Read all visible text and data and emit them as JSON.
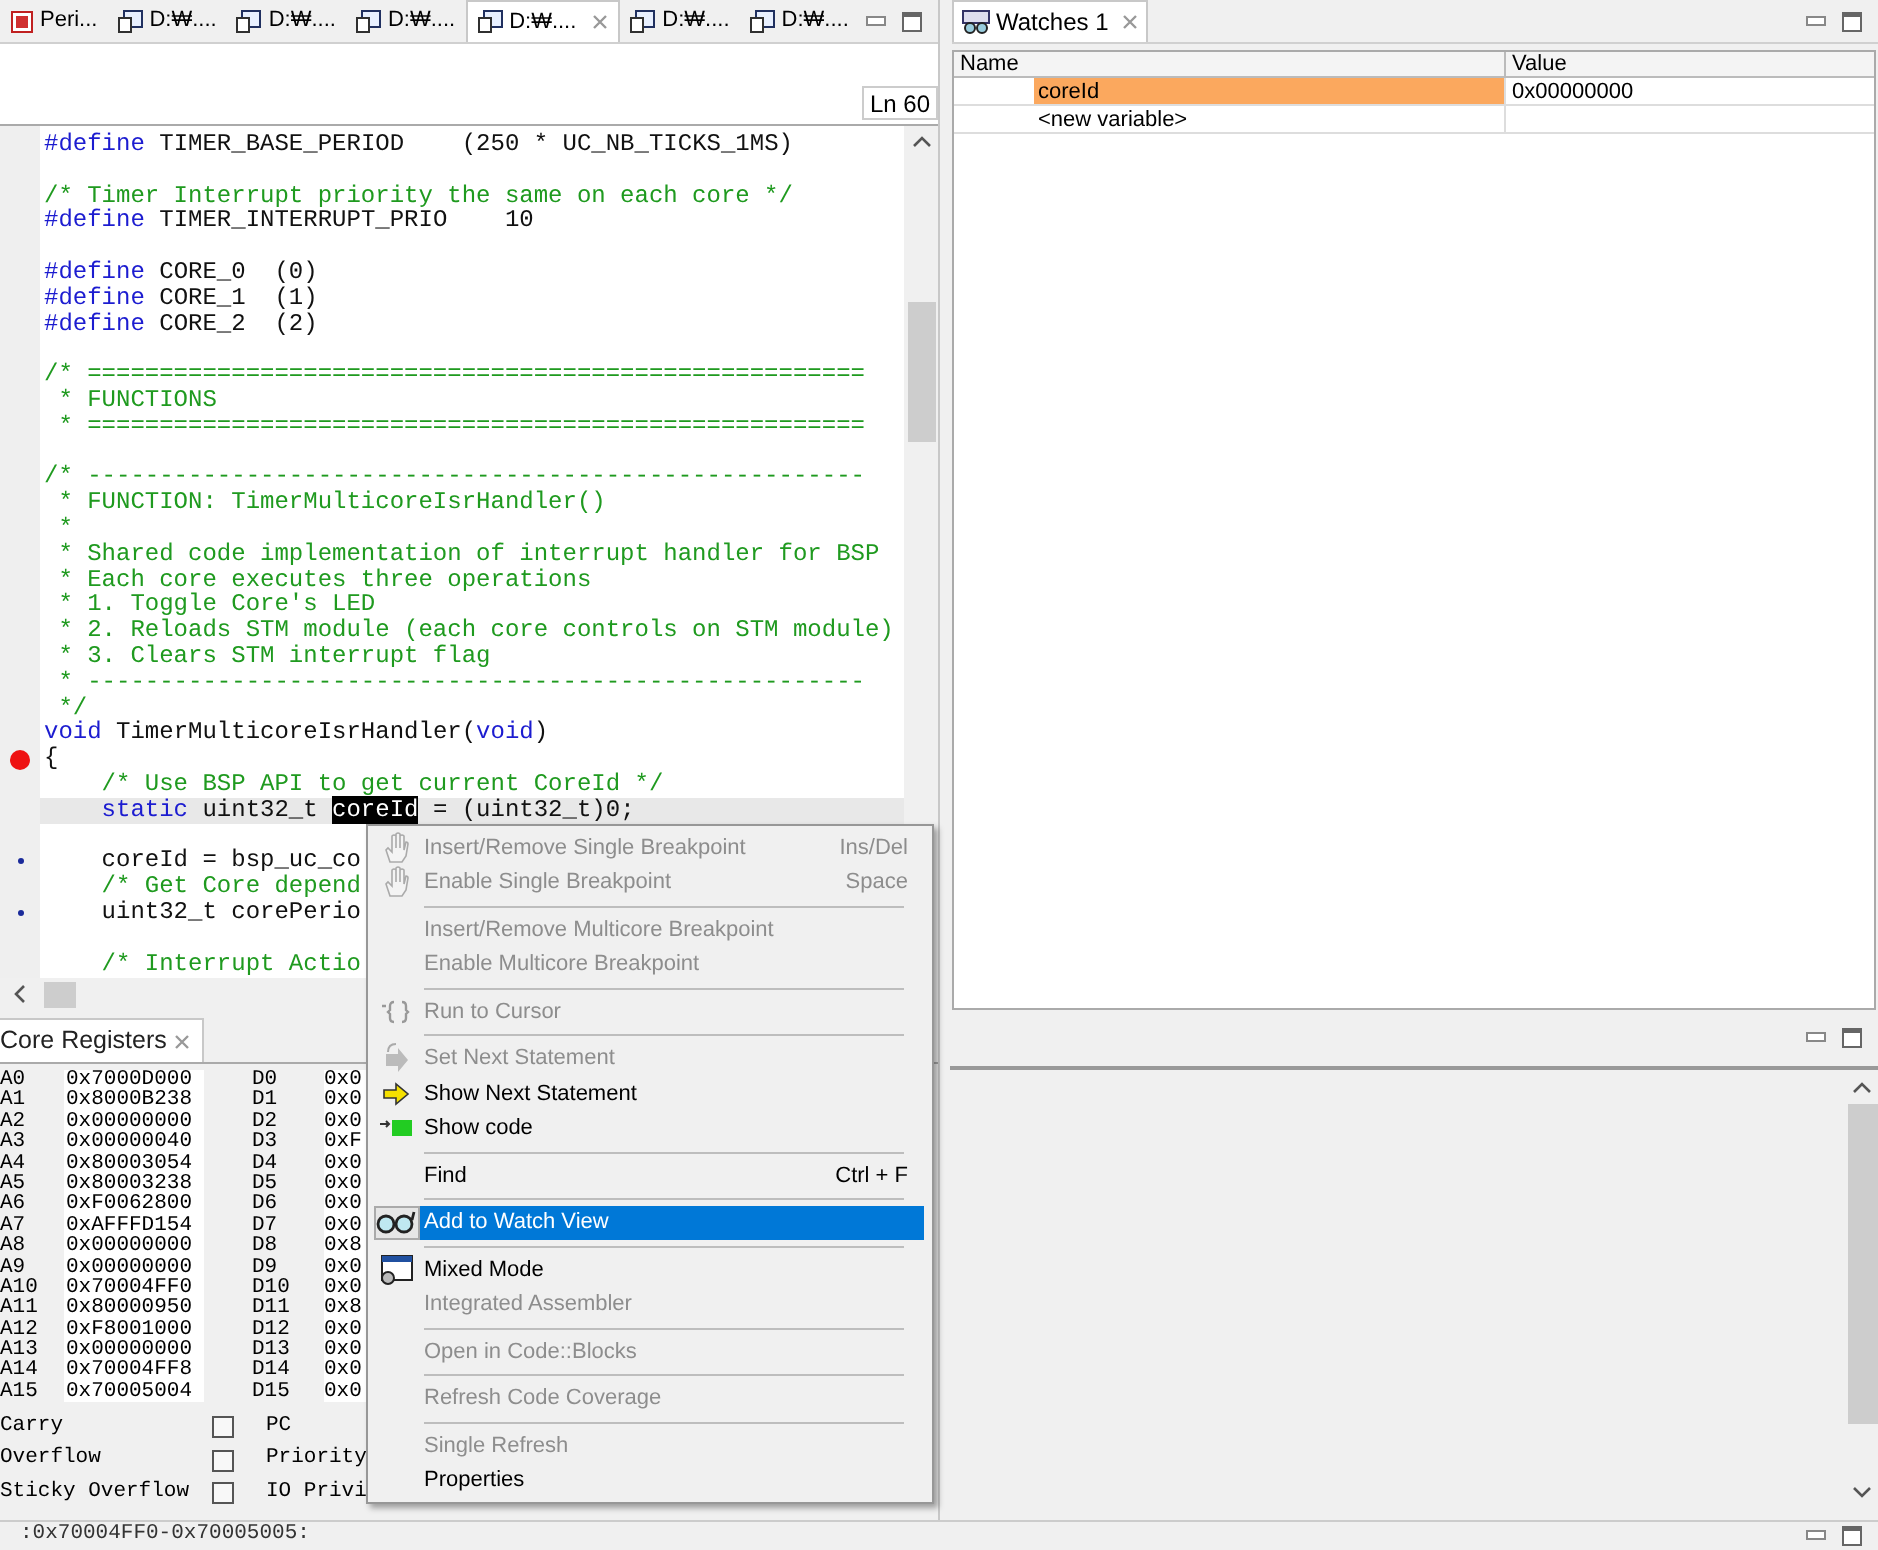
{
  "editor_tabs": [
    {
      "label": "Peri...",
      "kind": "peripheral",
      "selected": false
    },
    {
      "label": "D:₩....",
      "kind": "file",
      "selected": false
    },
    {
      "label": "D:₩....",
      "kind": "file",
      "selected": false
    },
    {
      "label": "D:₩....",
      "kind": "file",
      "selected": false
    },
    {
      "label": "D:₩....",
      "kind": "file",
      "selected": true
    },
    {
      "label": "D:₩....",
      "kind": "file",
      "selected": false
    },
    {
      "label": "D:₩....",
      "kind": "file",
      "selected": false
    }
  ],
  "line_indicator": "Ln 60",
  "code_lines": [
    {
      "kind": "code",
      "segments": [
        {
          "kind": "keyword",
          "text": "#define"
        },
        {
          "kind": "plain",
          "text": " TIMER_BASE_PERIOD    (250 * UC_NB_TICKS_1MS)"
        }
      ]
    },
    {
      "kind": "blank"
    },
    {
      "kind": "code",
      "segments": [
        {
          "kind": "comment",
          "text": "/* Timer Interrupt priority the same on each core */"
        }
      ]
    },
    {
      "kind": "code",
      "segments": [
        {
          "kind": "keyword",
          "text": "#define"
        },
        {
          "kind": "plain",
          "text": " TIMER_INTERRUPT_PRIO    10"
        }
      ]
    },
    {
      "kind": "blank"
    },
    {
      "kind": "code",
      "segments": [
        {
          "kind": "keyword",
          "text": "#define"
        },
        {
          "kind": "plain",
          "text": " CORE_0  (0)"
        }
      ]
    },
    {
      "kind": "code",
      "segments": [
        {
          "kind": "keyword",
          "text": "#define"
        },
        {
          "kind": "plain",
          "text": " CORE_1  (1)"
        }
      ]
    },
    {
      "kind": "code",
      "segments": [
        {
          "kind": "keyword",
          "text": "#define"
        },
        {
          "kind": "plain",
          "text": " CORE_2  (2)"
        }
      ]
    },
    {
      "kind": "blank"
    },
    {
      "kind": "code",
      "segments": [
        {
          "kind": "comment",
          "text": "/* ======================================================"
        }
      ]
    },
    {
      "kind": "code",
      "segments": [
        {
          "kind": "comment",
          "text": " * FUNCTIONS"
        }
      ]
    },
    {
      "kind": "code",
      "segments": [
        {
          "kind": "comment",
          "text": " * ======================================================"
        }
      ]
    },
    {
      "kind": "blank"
    },
    {
      "kind": "code",
      "segments": [
        {
          "kind": "comment",
          "text": "/* ------------------------------------------------------"
        }
      ]
    },
    {
      "kind": "code",
      "segments": [
        {
          "kind": "comment",
          "text": " * FUNCTION: TimerMulticoreIsrHandler()"
        }
      ]
    },
    {
      "kind": "code",
      "segments": [
        {
          "kind": "comment",
          "text": " *"
        }
      ]
    },
    {
      "kind": "code",
      "segments": [
        {
          "kind": "comment",
          "text": " * Shared code implementation of interrupt handler for BSP"
        }
      ]
    },
    {
      "kind": "code",
      "segments": [
        {
          "kind": "comment",
          "text": " * Each core executes three operations"
        }
      ]
    },
    {
      "kind": "code",
      "segments": [
        {
          "kind": "comment",
          "text": " * 1. Toggle Core's LED"
        }
      ]
    },
    {
      "kind": "code",
      "segments": [
        {
          "kind": "comment",
          "text": " * 2. Reloads STM module (each core controls on STM module)"
        }
      ]
    },
    {
      "kind": "code",
      "segments": [
        {
          "kind": "comment",
          "text": " * 3. Clears STM interrupt flag"
        }
      ]
    },
    {
      "kind": "code",
      "segments": [
        {
          "kind": "comment",
          "text": " * ------------------------------------------------------"
        }
      ]
    },
    {
      "kind": "code",
      "segments": [
        {
          "kind": "comment",
          "text": " */"
        }
      ]
    },
    {
      "kind": "code",
      "segments": [
        {
          "kind": "keyword",
          "text": "void"
        },
        {
          "kind": "plain",
          "text": " TimerMulticoreIsrHandler("
        },
        {
          "kind": "keyword",
          "text": "void"
        },
        {
          "kind": "plain",
          "text": ")"
        }
      ]
    },
    {
      "kind": "breakpoint",
      "segments": [
        {
          "kind": "plain",
          "text": "{"
        }
      ]
    },
    {
      "kind": "code",
      "segments": [
        {
          "kind": "comment",
          "text": "    /* Use BSP API to get current CoreId */"
        }
      ]
    },
    {
      "kind": "code",
      "current": true,
      "segments": [
        {
          "kind": "keyword",
          "text": "    static"
        },
        {
          "kind": "plain",
          "text": " uint32_t "
        },
        {
          "kind": "selection",
          "text": "coreId"
        },
        {
          "kind": "plain",
          "text": " = (uint32_t)0;"
        }
      ]
    },
    {
      "kind": "blank"
    },
    {
      "kind": "dot",
      "segments": [
        {
          "kind": "plain",
          "text": "    coreId = bsp_uc_co"
        }
      ]
    },
    {
      "kind": "code",
      "segments": [
        {
          "kind": "comment",
          "text": "    /* Get Core depend"
        }
      ]
    },
    {
      "kind": "dot",
      "segments": [
        {
          "kind": "plain",
          "text": "    uint32_t corePerio"
        }
      ]
    },
    {
      "kind": "blank"
    },
    {
      "kind": "code",
      "segments": [
        {
          "kind": "comment",
          "text": "    /* Interrupt Actio"
        }
      ]
    }
  ],
  "watches": {
    "tab": "Watches 1",
    "columns": [
      "Name",
      "Value"
    ],
    "rows": [
      {
        "name": "coreId",
        "value": "0x00000000",
        "highlighted": true
      },
      {
        "name": "<new variable>",
        "highlighted": false
      }
    ]
  },
  "registers": {
    "tab": "Core Registers",
    "rows": [
      {
        "a": "A0",
        "a_value": "0x7000D000",
        "d": "D0",
        "d_value": "0x0"
      },
      {
        "a": "A1",
        "a_value": "0x8000B238",
        "d": "D1",
        "d_value": "0x0"
      },
      {
        "a": "A2",
        "a_value": "0x00000000",
        "d": "D2",
        "d_value": "0x0"
      },
      {
        "a": "A3",
        "a_value": "0x00000040",
        "d": "D3",
        "d_value": "0xF"
      },
      {
        "a": "A4",
        "a_value": "0x80003054",
        "d": "D4",
        "d_value": "0x0"
      },
      {
        "a": "A5",
        "a_value": "0x80003238",
        "d": "D5",
        "d_value": "0x0"
      },
      {
        "a": "A6",
        "a_value": "0xF0062800",
        "d": "D6",
        "d_value": "0x0"
      },
      {
        "a": "A7",
        "a_value": "0xAFFFD154",
        "d": "D7",
        "d_value": "0x0"
      },
      {
        "a": "A8",
        "a_value": "0x00000000",
        "d": "D8",
        "d_value": "0x8"
      },
      {
        "a": "A9",
        "a_value": "0x00000000",
        "d": "D9",
        "d_value": "0x0"
      },
      {
        "a": "A10",
        "a_value": "0x70004FF0",
        "d": "D10",
        "d_value": "0x0"
      },
      {
        "a": "A11",
        "a_value": "0x80000950",
        "d": "D11",
        "d_value": "0x8"
      },
      {
        "a": "A12",
        "a_value": "0xF8001000",
        "d": "D12",
        "d_value": "0x0"
      },
      {
        "a": "A13",
        "a_value": "0x00000000",
        "d": "D13",
        "d_value": "0x0"
      },
      {
        "a": "A14",
        "a_value": "0x70004FF8",
        "d": "D14",
        "d_value": "0x0"
      },
      {
        "a": "A15",
        "a_value": "0x70005004",
        "d": "D15",
        "d_value": "0x0"
      }
    ],
    "flags": [
      {
        "label": "Carry",
        "checked": false,
        "right_label": "PC"
      },
      {
        "label": "Overflow",
        "checked": false,
        "right_label": "Priority"
      },
      {
        "label": "Sticky Overflow",
        "checked": false,
        "right_label": "IO Privi"
      }
    ]
  },
  "bottom_strip": ":0x70004FF0-0x70005005:",
  "context_menu": [
    {
      "kind": "hand",
      "label": "Insert/Remove Single Breakpoint",
      "shortcut": "Ins/Del",
      "disabled": true,
      "selected": false
    },
    {
      "kind": "hand",
      "label": "Enable Single Breakpoint",
      "shortcut": "Space",
      "disabled": true,
      "selected": false
    },
    {
      "kind": "separator"
    },
    {
      "kind": "plain",
      "label": "Insert/Remove Multicore Breakpoint",
      "disabled": true,
      "selected": false
    },
    {
      "kind": "plain",
      "label": "Enable Multicore Breakpoint",
      "disabled": true,
      "selected": false
    },
    {
      "kind": "separator"
    },
    {
      "kind": "braces",
      "label": "Run to Cursor",
      "disabled": true,
      "selected": false
    },
    {
      "kind": "separator"
    },
    {
      "kind": "jump",
      "label": "Set Next Statement",
      "disabled": true,
      "selected": false
    },
    {
      "kind": "arrow",
      "label": "Show Next Statement",
      "disabled": false,
      "selected": false
    },
    {
      "kind": "block",
      "label": "Show code",
      "disabled": false,
      "selected": false
    },
    {
      "kind": "separator"
    },
    {
      "kind": "plain",
      "label": "Find",
      "shortcut": "Ctrl + F",
      "disabled": false,
      "selected": false
    },
    {
      "kind": "separator"
    },
    {
      "kind": "glasses",
      "label": "Add to Watch View",
      "disabled": false,
      "selected": true
    },
    {
      "kind": "separator"
    },
    {
      "kind": "window",
      "label": "Mixed Mode",
      "disabled": false,
      "selected": false
    },
    {
      "kind": "plain",
      "label": "Integrated Assembler",
      "disabled": true,
      "selected": false
    },
    {
      "kind": "separator"
    },
    {
      "kind": "plain",
      "label": "Open in Code::Blocks",
      "disabled": true,
      "selected": false
    },
    {
      "kind": "separator"
    },
    {
      "kind": "plain",
      "label": "Refresh Code Coverage",
      "disabled": true,
      "selected": false
    },
    {
      "kind": "separator"
    },
    {
      "kind": "plain",
      "label": "Single Refresh",
      "disabled": true,
      "selected": false
    },
    {
      "kind": "plain",
      "label": "Properties",
      "disabled": false,
      "selected": false
    }
  ]
}
